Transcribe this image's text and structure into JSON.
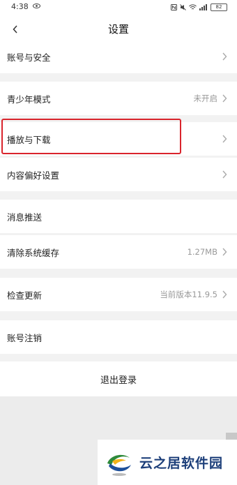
{
  "status_bar": {
    "time": "4:38",
    "battery": "82"
  },
  "header": {
    "title": "设置"
  },
  "rows": [
    {
      "label": "账号与安全",
      "value": ""
    },
    {
      "label": "青少年模式",
      "value": "未开启"
    },
    {
      "label": "播放与下载",
      "value": ""
    },
    {
      "label": "内容偏好设置",
      "value": ""
    },
    {
      "label": "消息推送",
      "value": ""
    },
    {
      "label": "清除系统缓存",
      "value": "1.27MB"
    },
    {
      "label": "检查更新",
      "value": "当前版本11.9.5"
    },
    {
      "label": "账号注销",
      "value": ""
    }
  ],
  "logout": {
    "label": "退出登录"
  },
  "watermark": {
    "text": "云之居软件园"
  },
  "colors": {
    "highlight": "#d9242c",
    "background": "#f2f2f2",
    "card": "#ffffff"
  }
}
